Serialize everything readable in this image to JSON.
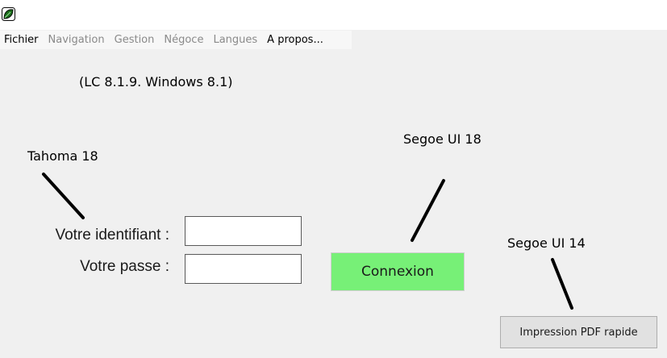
{
  "app": {
    "icon": "leaf-icon",
    "icon_color": "#1a6b1a"
  },
  "menu": {
    "items": [
      {
        "label": "Fichier",
        "enabled": true
      },
      {
        "label": "Navigation",
        "enabled": false
      },
      {
        "label": "Gestion",
        "enabled": false
      },
      {
        "label": "Négoce",
        "enabled": false
      },
      {
        "label": "Langues",
        "enabled": false
      },
      {
        "label": "A propos...",
        "enabled": true
      }
    ]
  },
  "version_text": "(LC 8.1.9. Windows 8.1)",
  "annotations": {
    "tahoma": "Tahoma 18",
    "segoe18": "Segoe UI 18",
    "segoe14": "Segoe UI 14"
  },
  "login": {
    "id_label": "Votre identifiant :",
    "id_value": "",
    "password_label": "Votre passe :",
    "password_value": ""
  },
  "buttons": {
    "connexion": "Connexion",
    "connexion_color": "#77f077",
    "pdf": "Impression PDF rapide"
  }
}
